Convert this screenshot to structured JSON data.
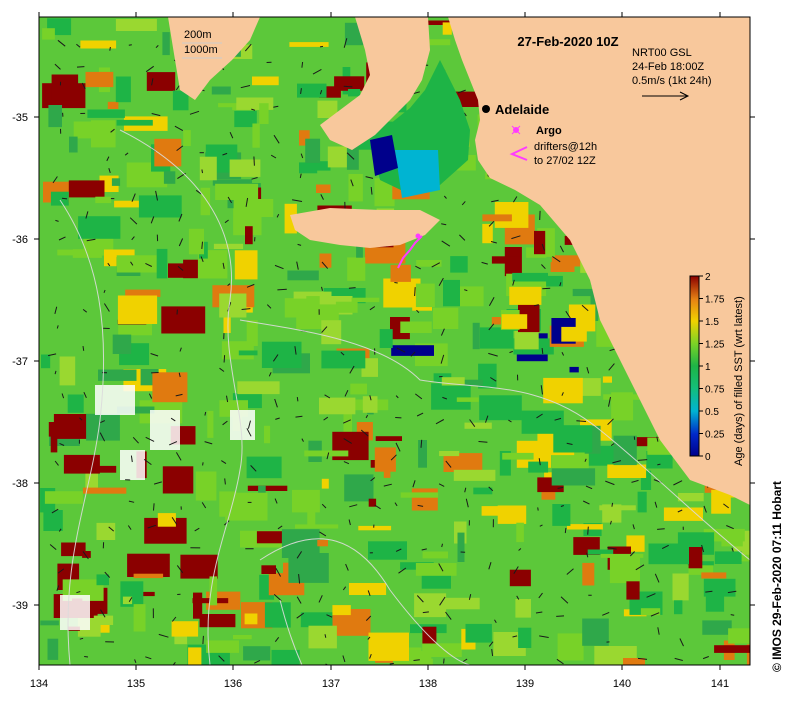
{
  "map": {
    "title": "27-Feb-2020 10Z",
    "product": {
      "line1": "NRT00 GSL",
      "line2": "24-Feb 18:00Z",
      "line3": "0.5m/s (1kt 24h)"
    },
    "contours": {
      "label1": "200m",
      "label2": "1000m"
    },
    "city": "Adelaide",
    "legend": {
      "argo": "Argo",
      "drifters_line1": "drifters@12h",
      "drifters_line2": "to 27/02 12Z"
    },
    "colorbar": {
      "label": "Age (days) of filled SST (wrt latest)",
      "ticks": [
        "2",
        "1.75",
        "1.5",
        "1.25",
        "1",
        "0.75",
        "0.5",
        "0.25",
        "0"
      ]
    },
    "x_ticks": [
      "134",
      "135",
      "136",
      "137",
      "138",
      "139",
      "140",
      "141"
    ],
    "y_ticks": [
      "-35",
      "-36",
      "-37",
      "-38",
      "-39"
    ],
    "credit": "© IMOS 29-Feb-2020 07:11 Hobart",
    "colors": {
      "land": "#f8c89c",
      "age_0": "#00008b",
      "age_0_5": "#00b4d2",
      "age_1": "#1eb446",
      "age_1_25": "#78d228",
      "age_1_5": "#f0d200",
      "age_2": "#8b0000"
    }
  }
}
